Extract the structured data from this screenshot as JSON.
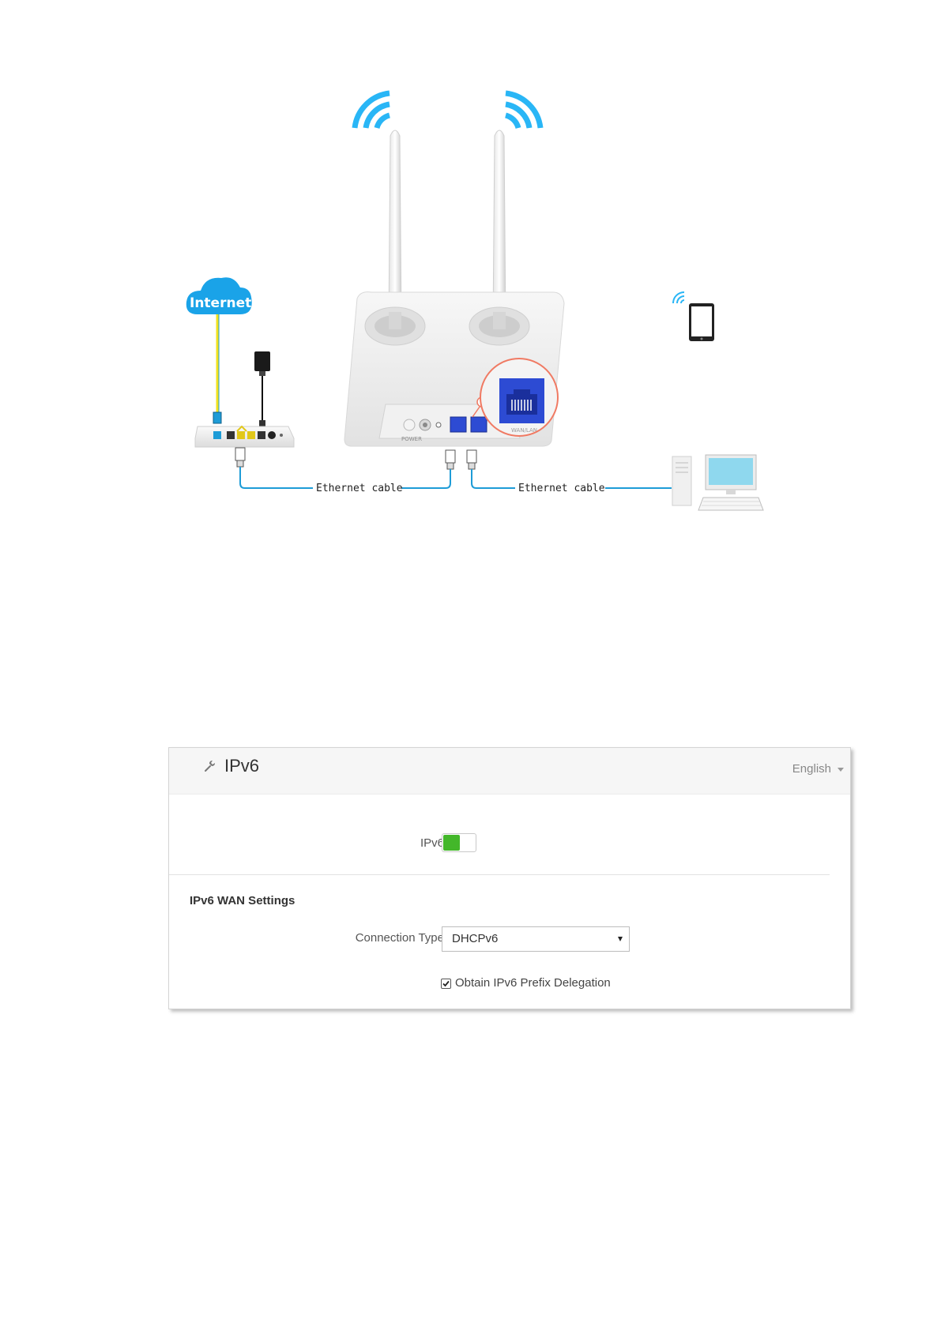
{
  "diagram": {
    "cloud_label": "Internet",
    "cable_left_label": "Ethernet cable",
    "cable_right_label": "Ethernet cable",
    "port_label": "WAN/LAN"
  },
  "settings_panel": {
    "title": "IPv6",
    "language": "English",
    "ipv6_toggle_label": "IPv6",
    "ipv6_enabled": true,
    "section_title": "IPv6 WAN Settings",
    "connection_type_label": "Connection Type",
    "connection_type_value": "DHCPv6",
    "prefix_delegation_label": "Obtain IPv6 Prefix Delegation",
    "prefix_delegation_checked": true
  },
  "colors": {
    "wifi_blue": "#29b6f6",
    "cable_blue": "#1e9cd7",
    "cloud_blue": "#1aa3e8",
    "toggle_green": "#43b72a",
    "port_blue": "#2d4bd3",
    "callout_red": "#f07a63"
  }
}
